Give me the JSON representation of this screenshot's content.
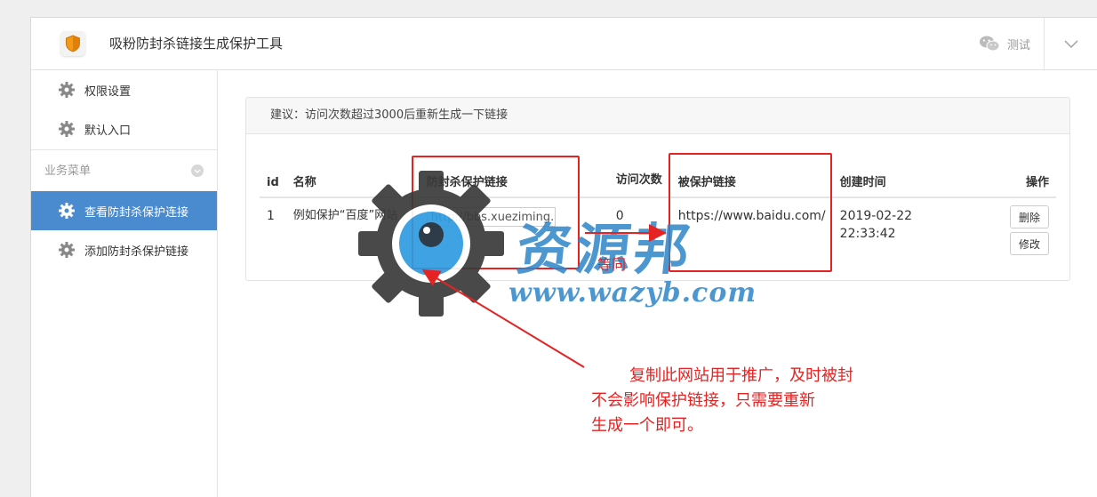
{
  "header": {
    "title": "吸粉防封杀链接生成保护工具",
    "user_name": "测试"
  },
  "sidebar": {
    "items": [
      {
        "label": "权限设置"
      },
      {
        "label": "默认入口"
      }
    ],
    "group_label": "业务菜单",
    "group_items": [
      {
        "label": "查看防封杀保护连接",
        "active": true
      },
      {
        "label": "添加防封杀保护链接",
        "active": false
      }
    ]
  },
  "panel": {
    "hint": "建议：访问次数超过3000后重新生成一下链接"
  },
  "table": {
    "headers": {
      "id": "id",
      "name": "名称",
      "protect_link": "防封杀保护链接",
      "visits": "访问次数",
      "target_link": "被保护链接",
      "created": "创建时间",
      "actions": "操作"
    },
    "rows": [
      {
        "id": "1",
        "name": "例如保护“百度”网站",
        "protect_link": "http://bbs.xueziming.com",
        "visits": "0",
        "target_link": "https://www.baidu.com/",
        "created_date": "2019-02-22",
        "created_time": "22:33:42",
        "delete_label": "删除",
        "edit_label": "修改"
      }
    ]
  },
  "annotations": {
    "equal": "等同",
    "note_line1": "复制此网站用于推广，及时被封",
    "note_line2": "不会影响保护链接，只需要重新",
    "note_line3": "生成一个即可。"
  },
  "watermark": {
    "brand": "资源邦",
    "url": "www.wazyb.com"
  },
  "colors": {
    "accent": "#4a8bd0",
    "annotation": "#e52323",
    "watermark": "#2f86c8"
  }
}
